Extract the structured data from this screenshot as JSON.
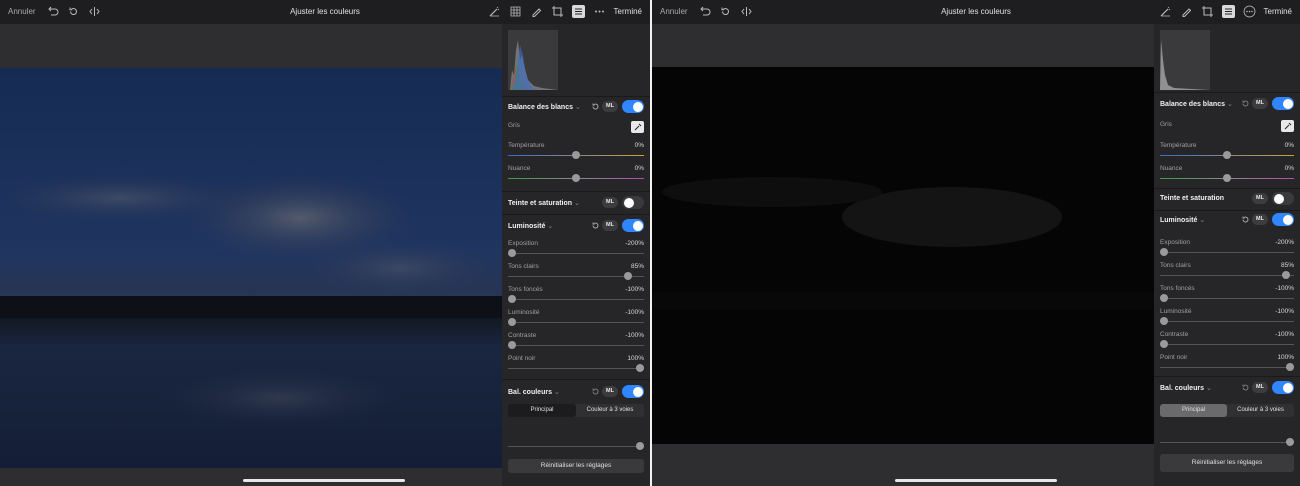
{
  "colors": {
    "accent": "#2f86ff",
    "toolbar": "#1e1e20",
    "panel": "#262628"
  },
  "left": {
    "toolbar": {
      "cancel": "Annuler",
      "title": "Ajuster les couleurs",
      "done": "Terminé"
    },
    "panel": {
      "white_balance": {
        "title": "Balance des blancs",
        "ml": "ML",
        "enabled": true,
        "gray": "Gris",
        "temperature_label": "Température",
        "temperature_value": "0%",
        "tint_label": "Nuance",
        "tint_value": "0%"
      },
      "hue_sat": {
        "title": "Teinte et saturation",
        "ml": "ML",
        "enabled": false
      },
      "luminosity": {
        "title": "Luminosité",
        "ml": "ML",
        "enabled": true,
        "sliders": [
          {
            "label": "Exposition",
            "value": "-200%"
          },
          {
            "label": "Tons clairs",
            "value": "85%"
          },
          {
            "label": "Tons foncés",
            "value": "-100%"
          },
          {
            "label": "Luminosité",
            "value": "-100%"
          },
          {
            "label": "Contraste",
            "value": "-100%"
          },
          {
            "label": "Point noir",
            "value": "100%"
          }
        ]
      },
      "color_balance": {
        "title": "Bal. couleurs",
        "ml": "ML",
        "enabled": true,
        "tab_main": "Principal",
        "tab_three": "Couleur à 3 voies"
      },
      "reset": "Réinitialiser les réglages"
    }
  },
  "right": {
    "toolbar": {
      "cancel": "Annuler",
      "title": "Ajuster les couleurs",
      "done": "Terminé"
    },
    "panel": {
      "white_balance": {
        "title": "Balance des blancs",
        "ml": "ML",
        "enabled": true,
        "gray": "Gris",
        "temperature_label": "Température",
        "temperature_value": "0%",
        "tint_label": "Nuance",
        "tint_value": "0%"
      },
      "hue_sat": {
        "title": "Teinte et saturation",
        "ml": "ML",
        "enabled": false
      },
      "luminosity": {
        "title": "Luminosité",
        "ml": "ML",
        "enabled": true,
        "sliders": [
          {
            "label": "Exposition",
            "value": "-200%"
          },
          {
            "label": "Tons clairs",
            "value": "85%"
          },
          {
            "label": "Tons foncés",
            "value": "-100%"
          },
          {
            "label": "Luminosité",
            "value": "-100%"
          },
          {
            "label": "Contraste",
            "value": "-100%"
          },
          {
            "label": "Point noir",
            "value": "100%"
          }
        ]
      },
      "color_balance": {
        "title": "Bal. couleurs",
        "ml": "ML",
        "enabled": true,
        "tab_main": "Principal",
        "tab_three": "Couleur à 3 voies"
      },
      "reset": "Réinitialiser les réglages"
    }
  }
}
